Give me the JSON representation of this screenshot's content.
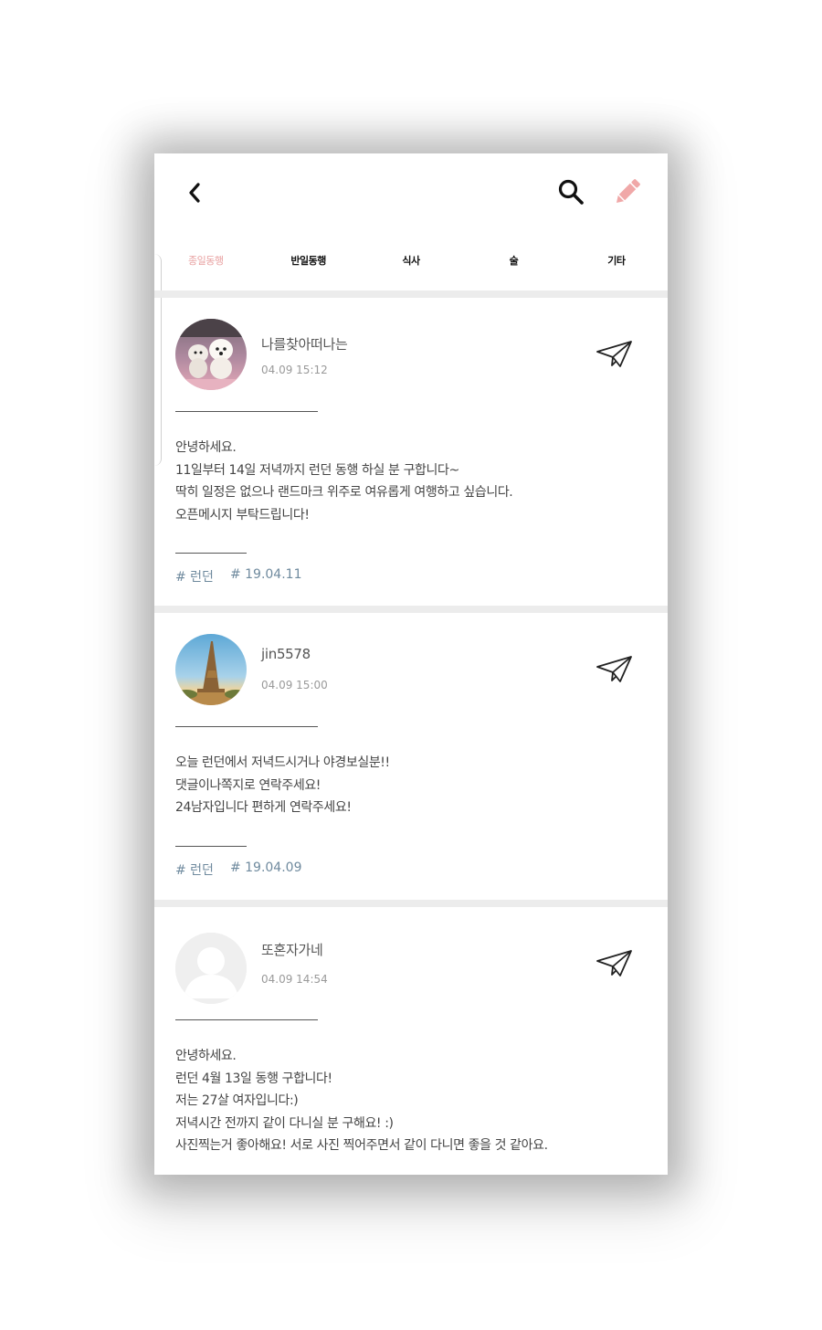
{
  "header": {
    "back_icon": "chevron-left-icon",
    "search_icon": "search-icon",
    "write_icon": "pencil-icon",
    "write_color": "#f0a8a8"
  },
  "tabs": [
    {
      "label": "종일동행",
      "active": true
    },
    {
      "label": "반일동행",
      "active": false
    },
    {
      "label": "식사",
      "active": false
    },
    {
      "label": "술",
      "active": false
    },
    {
      "label": "기타",
      "active": false
    }
  ],
  "posts": [
    {
      "username": "나를찾아떠나는",
      "time": "04.09 15:12",
      "avatar": "dogs-photo",
      "lines": [
        "안녕하세요.",
        "11일부터 14일 저녁까지 런던 동행 하실 분 구합니다~",
        "딱히 일정은 없으나 랜드마크 위주로 여유롭게 여행하고 싶습니다.",
        "오픈메시지 부탁드립니다!"
      ],
      "tags": [
        "# 런던",
        "# 19.04.11"
      ]
    },
    {
      "username": "jin5578",
      "time": "04.09 15:00",
      "avatar": "eiffel-tower-photo",
      "lines": [
        "오늘 런던에서 저녁드시거나 야경보실분!!",
        "댓글이나쪽지로 연락주세요!",
        "24남자입니다 편하게 연락주세요!"
      ],
      "tags": [
        "# 런던",
        "# 19.04.09"
      ]
    },
    {
      "username": "또혼자가네",
      "time": "04.09 14:54",
      "avatar": "default-avatar",
      "lines": [
        "안녕하세요.",
        "런던 4월 13일 동행 구합니다!",
        "저는 27살 여자입니다:)",
        "저녁시간 전까지 같이 다니실 분 구해요! :)",
        "사진찍는거 좋아해요! 서로 사진 찍어주면서 같이 다니면 좋을 것 같아요."
      ],
      "tags": []
    }
  ],
  "colors": {
    "active_tab": "#e8a0a0",
    "tag": "#6f8a9e",
    "divider": "#ececec"
  }
}
